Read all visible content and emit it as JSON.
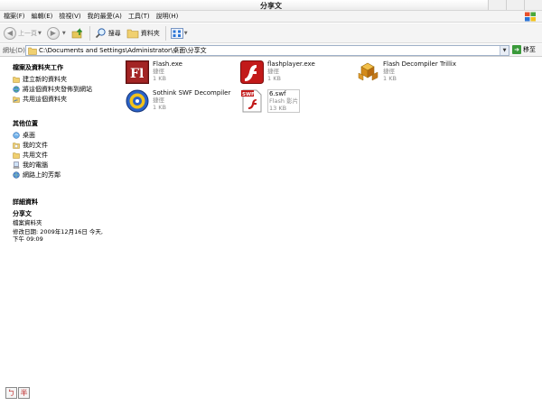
{
  "window": {
    "title": "分享文"
  },
  "menu": [
    "檔案(F)",
    "編輯(E)",
    "檢視(V)",
    "我的最愛(A)",
    "工具(T)",
    "說明(H)"
  ],
  "toolbar": {
    "back_label": "上一頁",
    "search_label": "搜尋",
    "folders_label": "資料夾"
  },
  "address": {
    "label": "網址(D)",
    "path": "C:\\Documents and Settings\\Administrator\\桌面\\分享文",
    "go_label": "移至"
  },
  "left": {
    "tasks_title": "檔案及資料夾工作",
    "tasks": [
      "建立新的資料夾",
      "將這個資料夾發佈到網站",
      "共用這個資料夾"
    ],
    "places_title": "其他位置",
    "places": [
      "桌面",
      "我的文件",
      "共用文件",
      "我的電腦",
      "網路上的芳鄰"
    ],
    "details_title": "詳細資料",
    "details": {
      "name": "分享文",
      "type": "檔案資料夾",
      "modified_line1": "修改日期: 2009年12月16日 今天,",
      "modified_line2": "下午 09:09"
    }
  },
  "files": [
    {
      "name": "Flash.exe",
      "type": "捷徑",
      "size": "1 KB",
      "icon": "flash-cs-icon"
    },
    {
      "name": "flashplayer.exe",
      "type": "捷徑",
      "size": "1 KB",
      "icon": "flash-player-icon"
    },
    {
      "name": "Flash Decompiler Trillix",
      "type": "捷徑",
      "size": "1 KB",
      "icon": "decompiler-cubes-icon"
    },
    {
      "name": "Sothink SWF Decompiler",
      "type": "捷徑",
      "size": "1 KB",
      "icon": "sothink-icon"
    },
    {
      "name": "6.swf",
      "type": "Flash 影片",
      "size": "13 KB",
      "icon": "swf-file-icon"
    }
  ],
  "ime": {
    "btn1": "ㄅ",
    "btn2": "半"
  }
}
